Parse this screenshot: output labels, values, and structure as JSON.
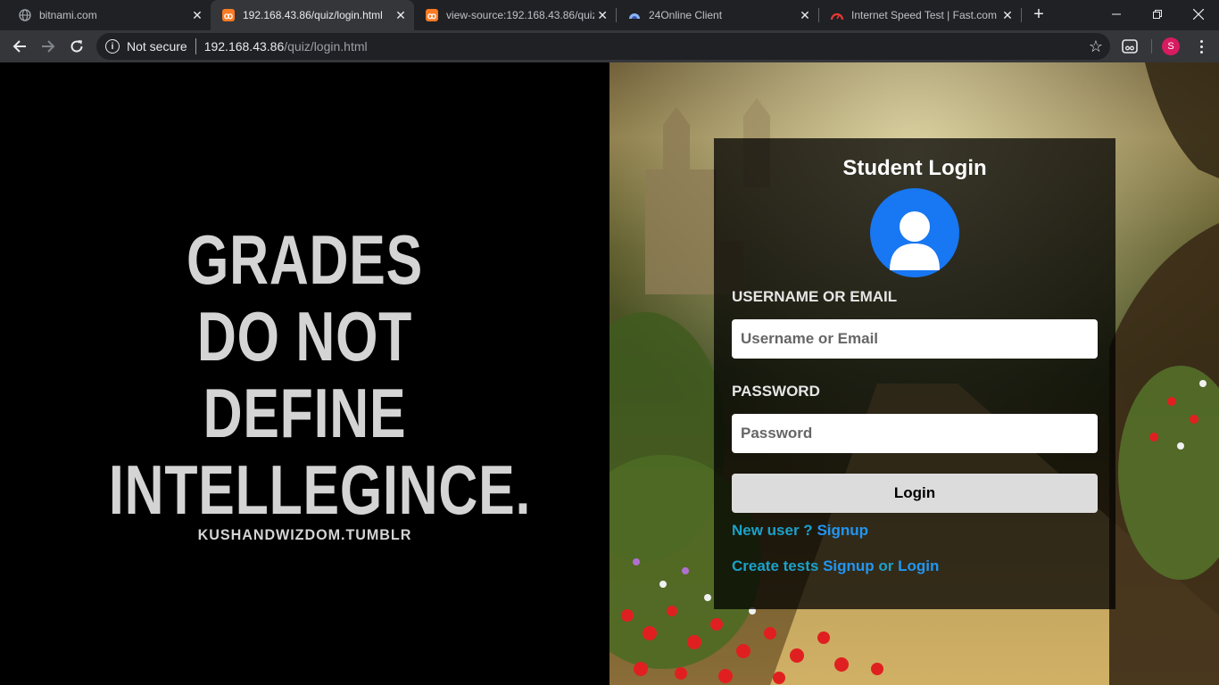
{
  "browser": {
    "tabs": [
      {
        "title": "bitnami.com",
        "icon": "globe-icon",
        "active": false
      },
      {
        "title": "192.168.43.86/quiz/login.html",
        "icon": "xampp-icon",
        "active": true
      },
      {
        "title": "view-source:192.168.43.86/quiz",
        "icon": "xampp-icon",
        "active": false
      },
      {
        "title": "24Online Client",
        "icon": "cloud-icon",
        "active": false
      },
      {
        "title": "Internet Speed Test | Fast.com",
        "icon": "speedometer-icon",
        "active": false
      }
    ],
    "security_label": "Not secure",
    "url_host": "192.168.43.86",
    "url_path": "/quiz/login.html",
    "avatar_initial": "S",
    "colors": {
      "tabbar": "#202124",
      "toolbar": "#35363a",
      "avatar": "#d81b60"
    }
  },
  "quote": {
    "lines": [
      "GRADES",
      "DO NOT",
      "DEFINE",
      "INTELLEGINCE."
    ],
    "credit": "KUSHANDWIZDOM.TUMBLR"
  },
  "login": {
    "title": "Student Login",
    "username_label": "USERNAME OR EMAIL",
    "username_placeholder": "Username or Email",
    "password_label": "PASSWORD",
    "password_placeholder": "Password",
    "button_label": "Login",
    "new_user_text": "New user ?",
    "signup_link": "Signup",
    "create_tests_text": "Create tests",
    "create_signup_link": "Signup",
    "or_text": "or",
    "create_login_link": "Login",
    "colors": {
      "avatar": "#1877f2",
      "link_muted": "#1ba1c9",
      "link_main": "#2196f3"
    }
  }
}
